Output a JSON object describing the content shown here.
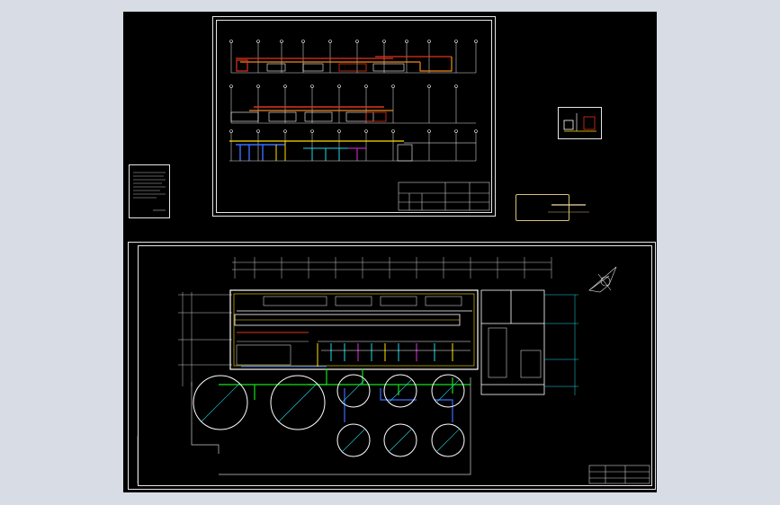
{
  "viewer": {
    "background_color": "#d8dce4",
    "canvas_color": "#000000"
  },
  "sheets": [
    {
      "id": "elevation-sheet",
      "label": ""
    },
    {
      "id": "plan-sheet",
      "label": ""
    }
  ],
  "stamp": {
    "title": "",
    "subtitle": ""
  },
  "colors": {
    "line_white": "#e6e6e6",
    "line_red": "#e0341f",
    "line_orange": "#f08a1e",
    "line_yellow": "#ffe000",
    "line_cyan": "#20d8e8",
    "line_green": "#18e018",
    "line_magenta": "#e030e0",
    "line_blue": "#3a6cff"
  },
  "icons": {
    "compass": "north-arrow-icon"
  }
}
